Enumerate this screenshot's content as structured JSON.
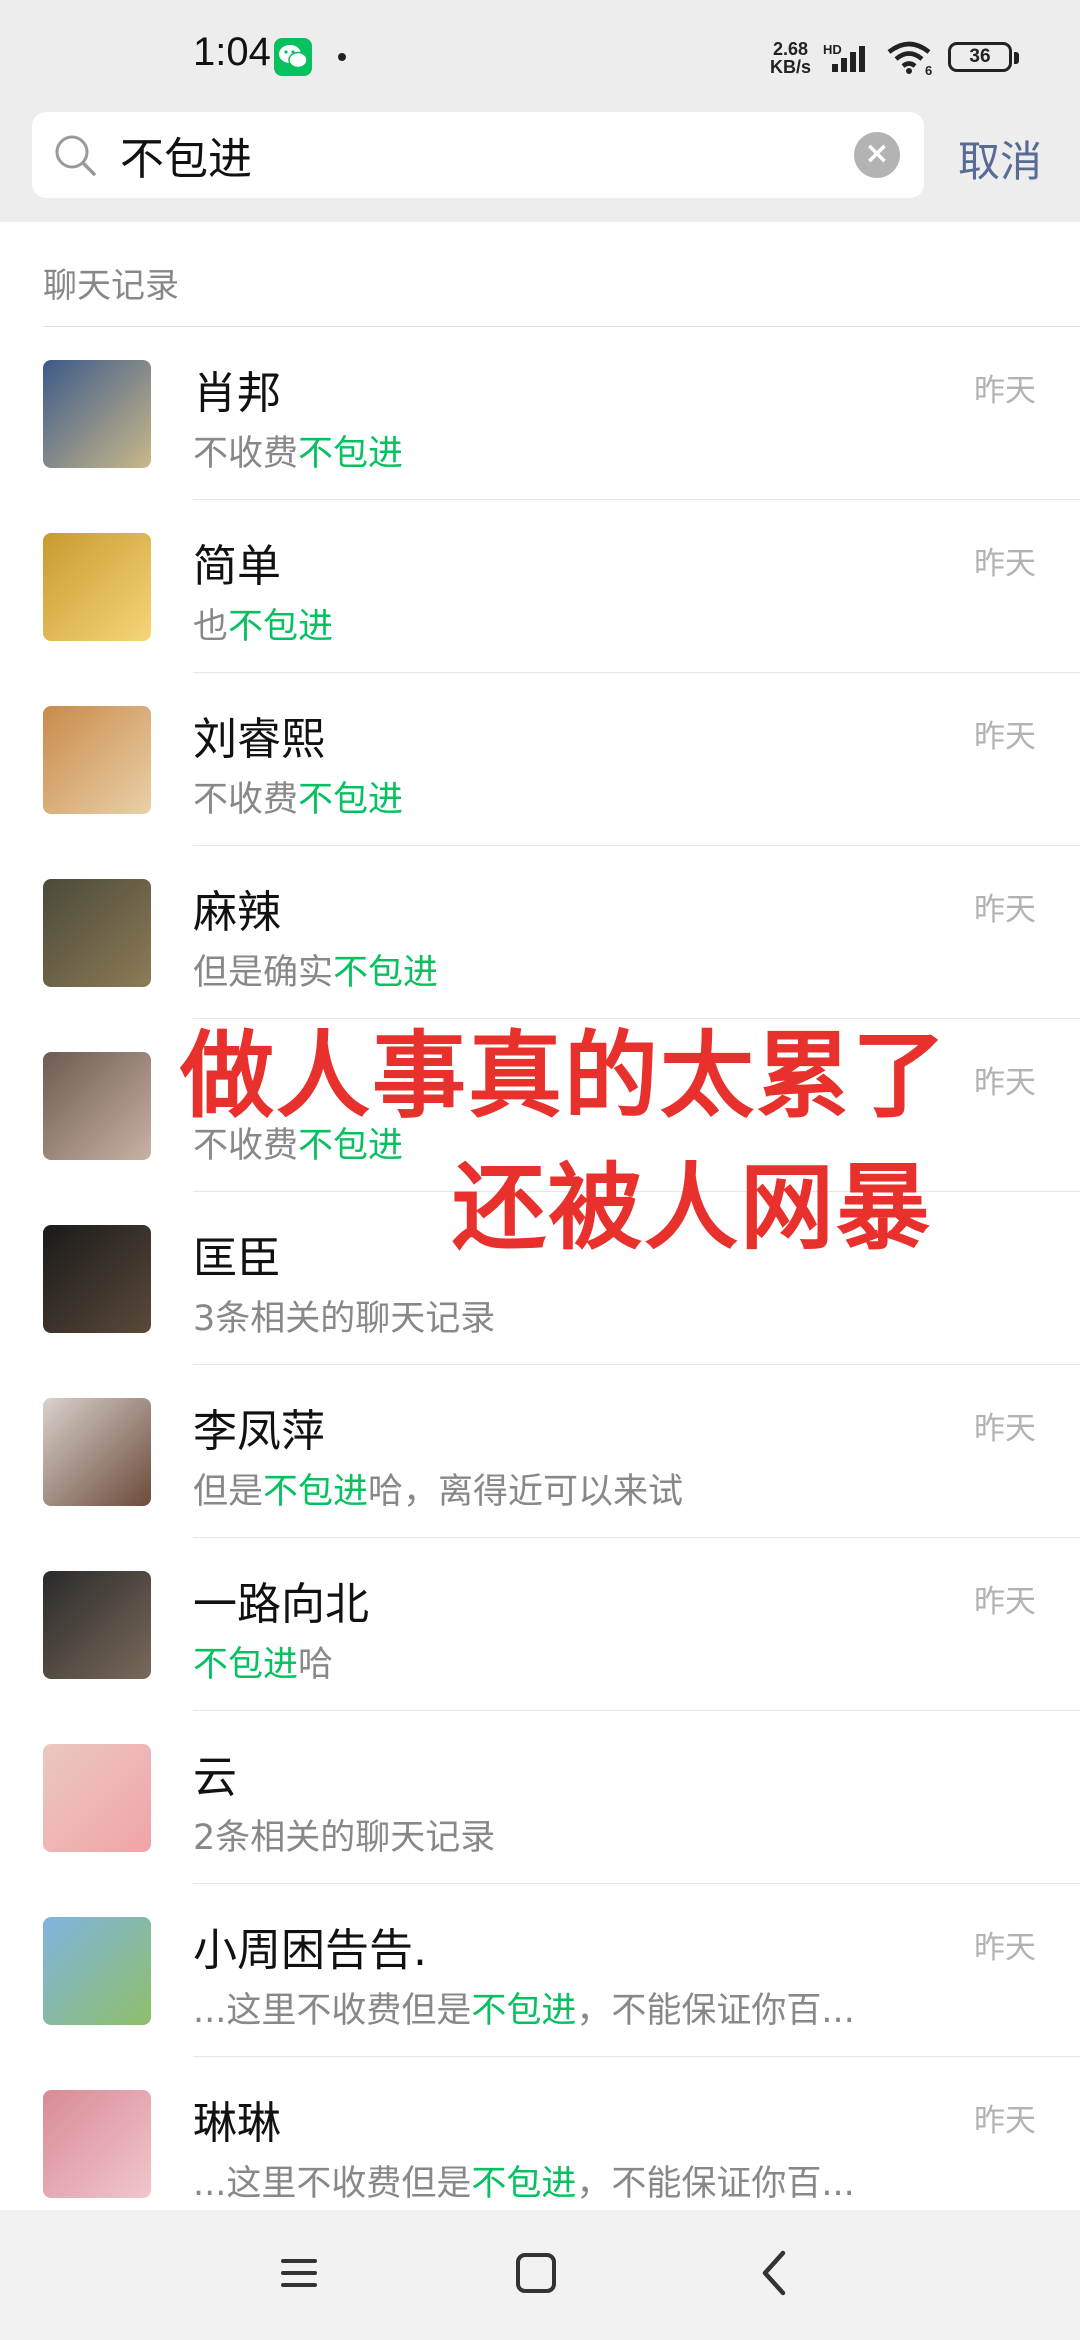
{
  "status_bar": {
    "time": "1:04",
    "net_speed_top": "2.68",
    "net_speed_bottom": "KB/s",
    "hd": "HD",
    "battery": "36"
  },
  "search": {
    "query": "不包进",
    "cancel_label": "取消"
  },
  "section_title": "聊天记录",
  "results": [
    {
      "name": "肖邦",
      "pre": "不收费",
      "hl": "不包进",
      "post": "",
      "time": "昨天",
      "avatar_colors": [
        "#3c5a8a",
        "#c9b88a"
      ]
    },
    {
      "name": "简单",
      "pre": "也",
      "hl": "不包进",
      "post": "",
      "time": "昨天",
      "avatar_colors": [
        "#c89a2e",
        "#f5d67a"
      ]
    },
    {
      "name": "刘睿熙",
      "pre": "不收费",
      "hl": "不包进",
      "post": "",
      "time": "昨天",
      "avatar_colors": [
        "#c98b4a",
        "#e9d0a9"
      ]
    },
    {
      "name": "麻辣",
      "pre": "但是确实",
      "hl": "不包进",
      "post": "",
      "time": "昨天",
      "avatar_colors": [
        "#4a4a3a",
        "#8d7b55"
      ]
    },
    {
      "name": "",
      "pre": "不收费",
      "hl": "不包进",
      "post": "",
      "time": "昨天",
      "avatar_colors": [
        "#6e5a50",
        "#c9b2a4"
      ]
    },
    {
      "name": "匡臣",
      "pre": "3条相关的聊天记录",
      "hl": "",
      "post": "",
      "time": "",
      "avatar_colors": [
        "#1a1a1a",
        "#5a4a3a"
      ]
    },
    {
      "name": "李凤萍",
      "pre": "但是",
      "hl": "不包进",
      "post": "哈，离得近可以来试",
      "time": "昨天",
      "avatar_colors": [
        "#d9d2cc",
        "#6b4a3a"
      ]
    },
    {
      "name": "一路向北",
      "pre": "",
      "hl": "不包进",
      "post": "哈",
      "time": "昨天",
      "avatar_colors": [
        "#2a2a2a",
        "#7a6a5a"
      ]
    },
    {
      "name": "云",
      "pre": "2条相关的聊天记录",
      "hl": "",
      "post": "",
      "time": "",
      "avatar_colors": [
        "#e9c9c0",
        "#f2a3a8"
      ]
    },
    {
      "name": "小周困告告.",
      "pre": "...这里不收费但是",
      "hl": "不包进",
      "post": "，不能保证你百...",
      "time": "昨天",
      "avatar_colors": [
        "#7fb4e0",
        "#8fbf6a"
      ]
    },
    {
      "name": "琳琳",
      "pre": "...这里不收费但是",
      "hl": "不包进",
      "post": "，不能保证你百...",
      "time": "昨天",
      "avatar_colors": [
        "#d98a96",
        "#f0c7cc"
      ]
    }
  ],
  "overlay": {
    "line1": "做人事真的太累了",
    "line2": "还被人网暴"
  },
  "icons": [
    "search-icon",
    "clear-icon",
    "menu-icon",
    "home-icon",
    "back-icon",
    "wechat-icon",
    "signal-icon",
    "wifi-icon",
    "battery-icon"
  ]
}
